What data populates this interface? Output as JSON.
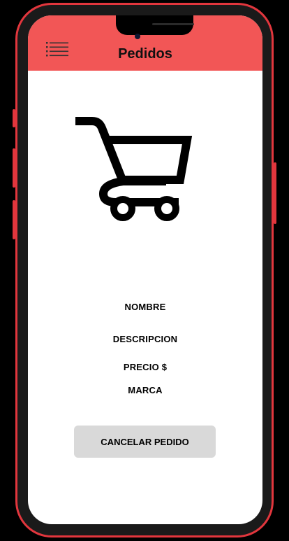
{
  "header": {
    "title": "Pedidos",
    "menu_icon": "list-menu-icon",
    "color": "#f25656"
  },
  "product": {
    "image_icon": "shopping-cart-icon",
    "nombre": "NOMBRE",
    "descripcion": "DESCRIPCION",
    "precio": "PRECIO $",
    "marca": "MARCA"
  },
  "actions": {
    "cancel_label": "CANCELAR PEDIDO",
    "cancel_bg": "#d9d9d9"
  },
  "device": {
    "frame_color": "#e2363d"
  }
}
